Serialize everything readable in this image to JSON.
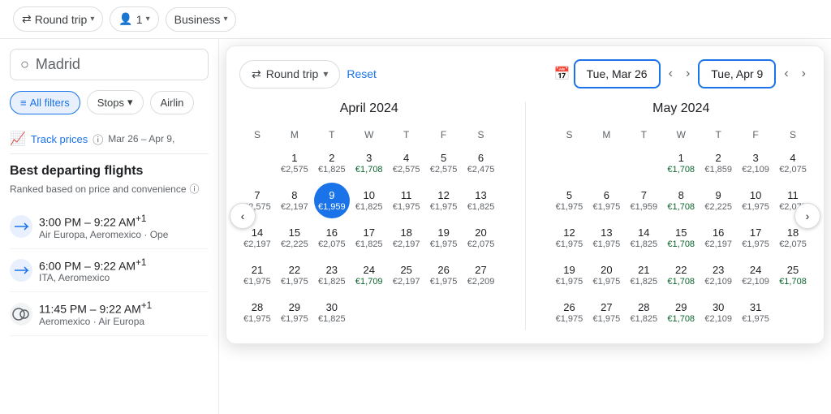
{
  "topBar": {
    "roundTrip": "Round trip",
    "passengers": "1",
    "cabinClass": "Business",
    "chevron": "▾"
  },
  "leftPanel": {
    "searchPlaceholder": "Madrid",
    "filters": {
      "allFilters": "All filters",
      "stops": "Stops",
      "airline": "Airlin"
    },
    "trackPrices": {
      "label": "Track prices",
      "dateRange": "Mar 26 – Apr 9,"
    },
    "sectionTitle": "Best departing flights",
    "sectionSub": "Ranked based on price and convenience",
    "flights": [
      {
        "time": "3:00 PM – 9:22 AM",
        "suffix": "+1",
        "airlines": "Air Europa, Aeromexico · Ope"
      },
      {
        "time": "6:00 PM – 9:22 AM",
        "suffix": "+1",
        "airlines": "ITA, Aeromexico"
      },
      {
        "time": "11:45 PM – 9:22 AM",
        "suffix": "+1",
        "airlines": "Aeromexico · Air Europa"
      }
    ]
  },
  "calendar": {
    "roundTripLabel": "Round trip",
    "resetLabel": "Reset",
    "departureDateLabel": "Tue, Mar 26",
    "returnDateLabel": "Tue, Apr 9",
    "prevNav": "‹",
    "nextNav": "›",
    "calLeftNav": "‹",
    "calRightNav": "›",
    "months": [
      {
        "title": "April 2024",
        "dayHeaders": [
          "S",
          "M",
          "T",
          "W",
          "T",
          "F",
          "S"
        ],
        "startOffset": 1,
        "days": [
          {
            "d": 1,
            "p": "€2,575"
          },
          {
            "d": 2,
            "p": "€1,825"
          },
          {
            "d": 3,
            "p": "€1,708",
            "low": true
          },
          {
            "d": 4,
            "p": "€2,575"
          },
          {
            "d": 5,
            "p": "€2,575"
          },
          {
            "d": 6,
            "p": "€2,475"
          },
          {
            "d": 7,
            "p": "€2,575"
          },
          {
            "d": 8,
            "p": "€2,197"
          },
          {
            "d": 9,
            "p": "€1,959",
            "selected": true
          },
          {
            "d": 10,
            "p": "€1,825"
          },
          {
            "d": 11,
            "p": "€1,975"
          },
          {
            "d": 12,
            "p": "€1,975"
          },
          {
            "d": 13,
            "p": "€1,825"
          },
          {
            "d": 14,
            "p": "€2,197"
          },
          {
            "d": 15,
            "p": "€2,225"
          },
          {
            "d": 16,
            "p": "€2,075"
          },
          {
            "d": 17,
            "p": "€1,825"
          },
          {
            "d": 18,
            "p": "€2,197"
          },
          {
            "d": 19,
            "p": "€1,975"
          },
          {
            "d": 20,
            "p": "€2,075"
          },
          {
            "d": 21,
            "p": "€1,975"
          },
          {
            "d": 22,
            "p": "€1,975"
          },
          {
            "d": 23,
            "p": "€1,825"
          },
          {
            "d": 24,
            "p": "€1,709",
            "low": true
          },
          {
            "d": 25,
            "p": "€2,197"
          },
          {
            "d": 26,
            "p": "€1,975"
          },
          {
            "d": 27,
            "p": "€2,209"
          },
          {
            "d": 28,
            "p": "€1,975"
          },
          {
            "d": 29,
            "p": "€1,975"
          },
          {
            "d": 30,
            "p": "€1,825"
          }
        ]
      },
      {
        "title": "May 2024",
        "dayHeaders": [
          "S",
          "M",
          "T",
          "W",
          "T",
          "F",
          "S"
        ],
        "startOffset": 3,
        "days": [
          {
            "d": 1,
            "p": "€1,708",
            "low": true
          },
          {
            "d": 2,
            "p": "€1,859"
          },
          {
            "d": 3,
            "p": "€2,109"
          },
          {
            "d": 4,
            "p": "€2,075"
          },
          {
            "d": 5,
            "p": "€1,975"
          },
          {
            "d": 6,
            "p": "€1,975"
          },
          {
            "d": 7,
            "p": "€1,959"
          },
          {
            "d": 8,
            "p": "€1,708",
            "low": true
          },
          {
            "d": 9,
            "p": "€2,225"
          },
          {
            "d": 10,
            "p": "€1,975"
          },
          {
            "d": 11,
            "p": "€2,075"
          },
          {
            "d": 12,
            "p": "€1,975"
          },
          {
            "d": 13,
            "p": "€1,975"
          },
          {
            "d": 14,
            "p": "€1,825"
          },
          {
            "d": 15,
            "p": "€1,708",
            "low": true
          },
          {
            "d": 16,
            "p": "€2,197"
          },
          {
            "d": 17,
            "p": "€1,975"
          },
          {
            "d": 18,
            "p": "€2,075"
          },
          {
            "d": 19,
            "p": "€1,975"
          },
          {
            "d": 20,
            "p": "€1,975"
          },
          {
            "d": 21,
            "p": "€1,825"
          },
          {
            "d": 22,
            "p": "€1,708",
            "low": true
          },
          {
            "d": 23,
            "p": "€2,109"
          },
          {
            "d": 24,
            "p": "€2,109"
          },
          {
            "d": 25,
            "p": "€1,708",
            "low": true
          },
          {
            "d": 26,
            "p": "€1,975"
          },
          {
            "d": 27,
            "p": "€1,975"
          },
          {
            "d": 28,
            "p": "€1,825"
          },
          {
            "d": 29,
            "p": "€1,708",
            "low": true
          },
          {
            "d": 30,
            "p": "€2,109"
          },
          {
            "d": 31,
            "p": "€1,975"
          }
        ]
      }
    ]
  }
}
